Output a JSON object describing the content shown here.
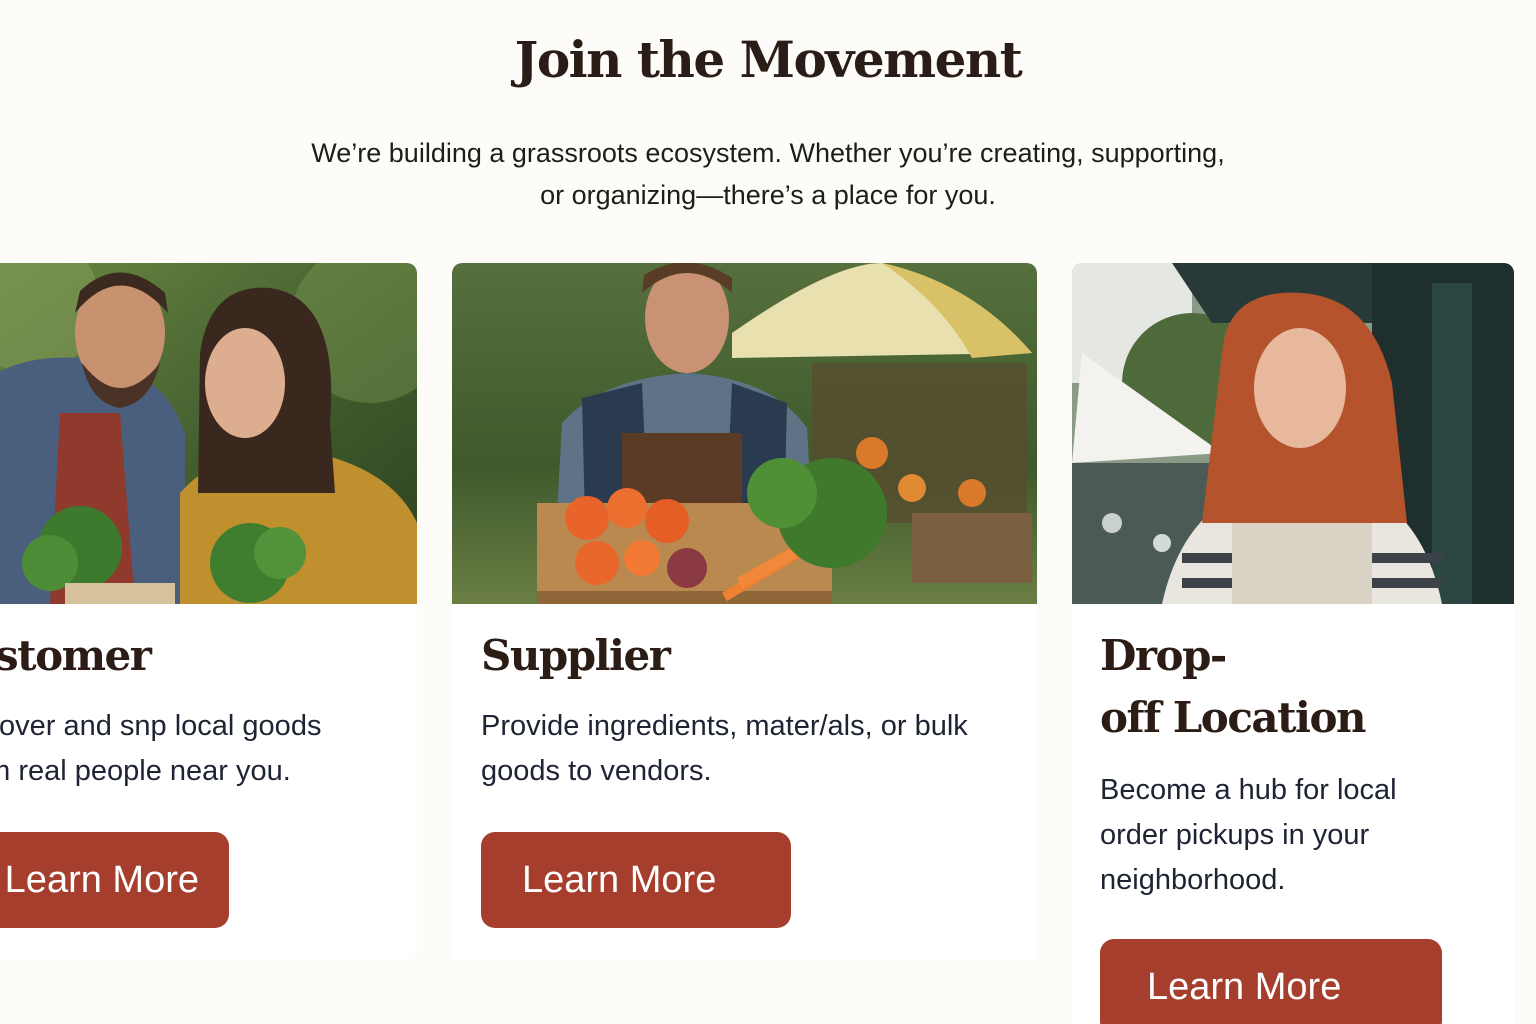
{
  "section": {
    "title": "Join the Movement",
    "intro_line1": "We’re building a grassroots ecosystem. Whether you’re creating, supporting,",
    "intro_line2": "or organizing—there’s a place for you."
  },
  "cards": [
    {
      "title": "ustomer",
      "desc_line1": "scover and snp local goods",
      "desc_line2": "om real people near you.",
      "button_label": "Learn More",
      "image": "couple-with-fresh-greens-photo"
    },
    {
      "title": "Supplier",
      "desc_line1": "Provide ingredients, mater/als, or bulk",
      "desc_line2": "goods to vendors.",
      "button_label": "Learn More",
      "image": "farmer-with-vegetable-crate-photo"
    },
    {
      "title_line1": "Drop-",
      "title_line2": "off Location",
      "desc_line1": "Become a hub for local",
      "desc_line2": "order pickups in your",
      "desc_line3": "neighborhood.",
      "button_label": "Learn More",
      "image": "woman-at-market-storefront-photo"
    }
  ],
  "colors": {
    "page_background": "#fdfcf8",
    "card_background": "#ffffff",
    "button": "#a63e2e",
    "heading_text": "#2b1c15",
    "body_text": "#1e2433"
  }
}
